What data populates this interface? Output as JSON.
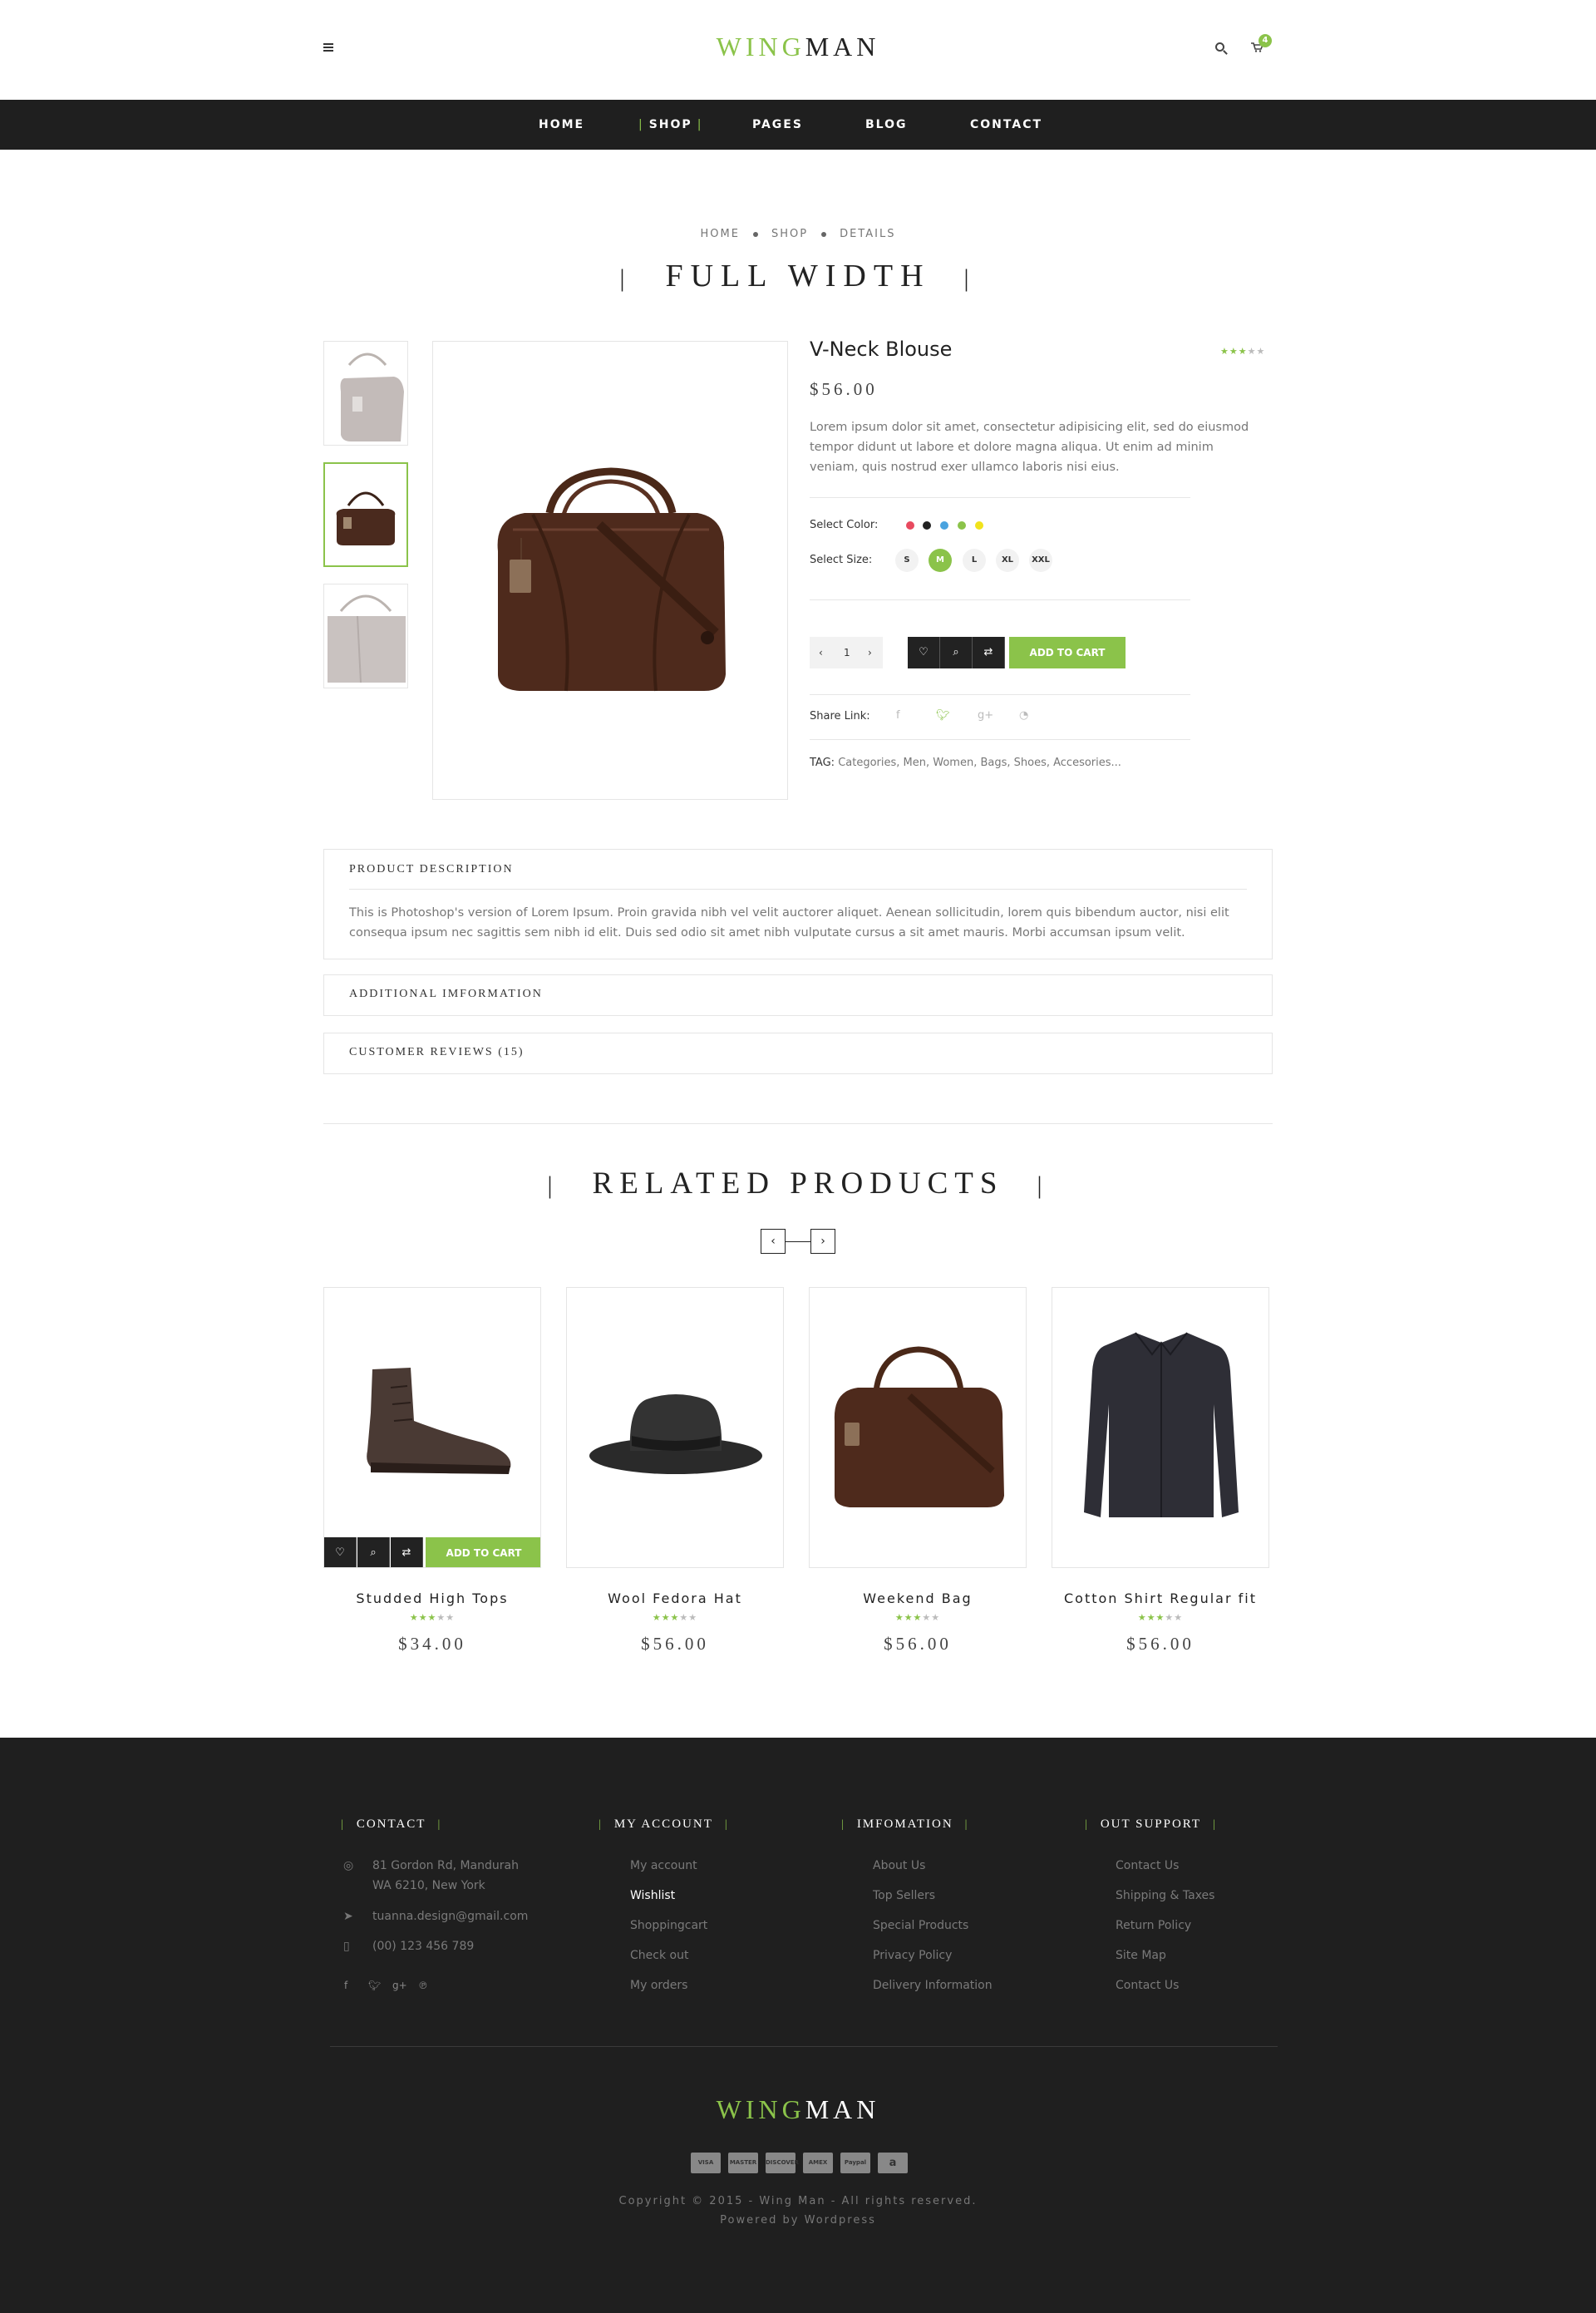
{
  "header": {
    "logo_part1": "WING",
    "logo_part2": "MAN",
    "cart_count": "4"
  },
  "nav": {
    "items": [
      "HOME",
      "SHOP",
      "PAGES",
      "BLOG",
      "CONTACT"
    ],
    "active": "SHOP"
  },
  "breadcrumb": [
    "HOME",
    "SHOP",
    "DETAILS"
  ],
  "page_title": "FULL WIDTH",
  "product": {
    "name": "V-Neck Blouse",
    "price": "$56.00",
    "rating": 3,
    "rating_max": 5,
    "description": "Lorem ipsum dolor sit amet, consectetur adipisicing elit, sed do eiusmod tempor didunt ut labore et dolore magna aliqua. Ut enim ad minim veniam, quis nostrud exer ullamco laboris nisi eius.",
    "color_label": "Select Color:",
    "colors": [
      "#e84a5f",
      "#222222",
      "#4aa3df",
      "#8bc34a",
      "#f1e31c"
    ],
    "size_label": "Select Size:",
    "sizes": [
      "S",
      "M",
      "L",
      "XL",
      "XXL"
    ],
    "selected_size": "M",
    "quantity": "1",
    "add_to_cart": "ADD TO CART",
    "share_label": "Share Link:",
    "tag_label": "TAG:",
    "tags": "Categories, Men, Women, Bags, Shoes, Accesories..."
  },
  "accordion": {
    "description_title": "PRODUCT DESCRIPTION",
    "description_body": "This is Photoshop's version of Lorem Ipsum. Proin gravida nibh vel velit auctorer aliquet. Aenean sollicitudin, lorem quis bibendum auctor, nisi elit consequa ipsum nec sagittis sem nibh id elit. Duis sed odio sit amet nibh vulputate cursus a sit amet mauris. Morbi accumsan ipsum velit.",
    "additional_title": "ADDITIONAL IMFORMATION",
    "reviews_title": "CUSTOMER REVIEWS (15)"
  },
  "related": {
    "title": "RELATED PRODUCTS",
    "add_to_cart": "ADD TO CART",
    "items": [
      {
        "name": "Studded High Tops",
        "price": "$34.00",
        "rating": 3
      },
      {
        "name": "Wool Fedora Hat",
        "price": "$56.00",
        "rating": 3
      },
      {
        "name": "Weekend Bag",
        "price": "$56.00",
        "rating": 3
      },
      {
        "name": "Cotton Shirt Regular fit",
        "price": "$56.00",
        "rating": 3
      }
    ]
  },
  "footer": {
    "contact": {
      "title": "CONTACT",
      "address1": "81 Gordon Rd, Mandurah",
      "address2": "WA 6210, New York",
      "email": "tuanna.design@gmail.com",
      "phone": "(00) 123 456 789"
    },
    "account": {
      "title": "MY ACCOUNT",
      "links": [
        "My account",
        "Wishlist",
        "Shoppingcart",
        "Check out",
        "My orders"
      ]
    },
    "information": {
      "title": "IMFOMATION",
      "links": [
        "About Us",
        "Top Sellers",
        "Special Products",
        "Privacy Policy",
        "Delivery Information"
      ]
    },
    "support": {
      "title": "OUT SUPPORT",
      "links": [
        "Contact Us",
        "Shipping & Taxes",
        "Return Policy",
        "Site Map",
        "Contact Us"
      ]
    },
    "logo_part1": "WING",
    "logo_part2": "MAN",
    "payments": [
      "VISA",
      "MASTER",
      "DISCOVER",
      "AMEX",
      "Paypal",
      "a"
    ],
    "copyright": "Copyright © 2015 - Wing Man - All rights reserved.",
    "powered": "Powered by Wordpress"
  }
}
